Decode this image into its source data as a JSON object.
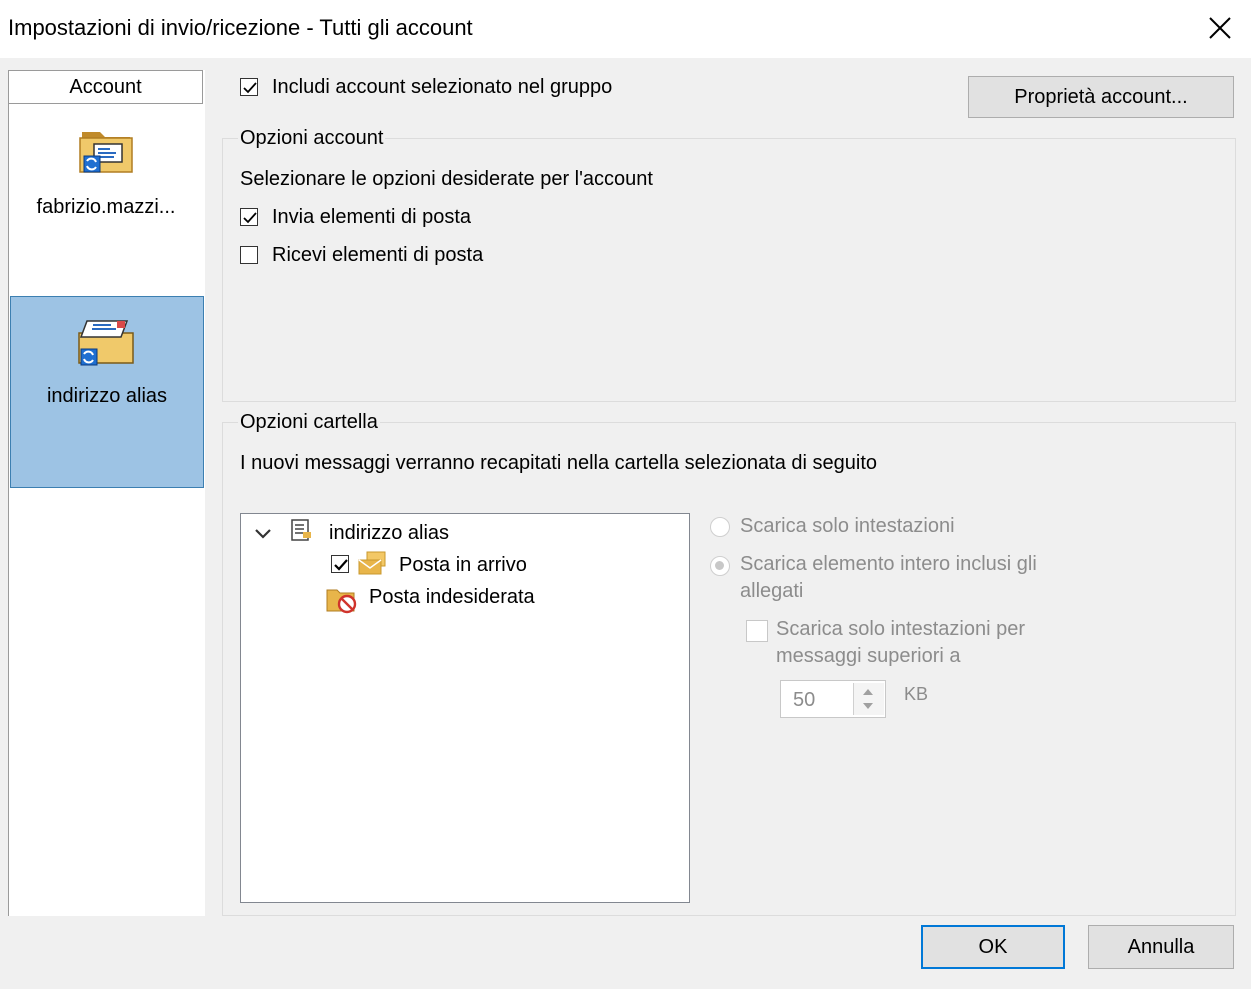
{
  "window": {
    "title": "Impostazioni di invio/ricezione - Tutti gli account"
  },
  "sidebar": {
    "header": "Account",
    "items": [
      {
        "label": "fabrizio.mazzi...",
        "icon": "account-folder-icon",
        "selected": false
      },
      {
        "label": "indirizzo alias",
        "icon": "account-folder-icon",
        "selected": true
      }
    ]
  },
  "include": {
    "label": "Includi account selezionato nel gruppo",
    "checked": true
  },
  "buttons": {
    "account_properties": "Proprietà account...",
    "ok": "OK",
    "cancel": "Annulla"
  },
  "account_options": {
    "title": "Opzioni account",
    "description": "Selezionare le opzioni desiderate per l'account",
    "send": {
      "label": "Invia elementi di posta",
      "checked": true
    },
    "receive": {
      "label": "Ricevi elementi di posta",
      "checked": false
    }
  },
  "folder_options": {
    "title": "Opzioni cartella",
    "description": "I nuovi messaggi verranno recapitati nella cartella selezionata di seguito",
    "tree": {
      "root": {
        "label": "indirizzo alias",
        "expanded": true
      },
      "children": [
        {
          "label": "Posta in arrivo",
          "checked": true,
          "icon": "inbox-folder-icon"
        },
        {
          "label": "Posta indesiderata",
          "icon": "junk-folder-icon"
        }
      ]
    },
    "download": {
      "headers_only": {
        "label": "Scarica solo intestazioni",
        "selected": false
      },
      "full_item_line1": "Scarica elemento intero inclusi gli",
      "full_item_line2": "allegati",
      "full_item_selected": true,
      "large_line1": "Scarica solo intestazioni per",
      "large_line2": "messaggi superiori a",
      "large_checked": false,
      "size_value": "50",
      "size_unit": "KB"
    }
  },
  "colors": {
    "selected_bg": "#9dc3e4",
    "accent": "#0078d7",
    "folder": "#e8b54a"
  }
}
